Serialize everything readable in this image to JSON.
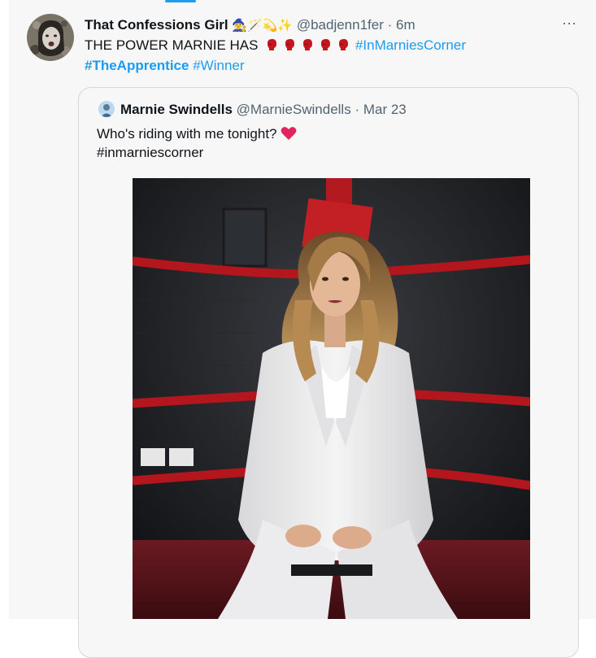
{
  "tweet": {
    "name": "That Confessions Girl",
    "name_emojis": "🧙‍♀️🪄💫✨",
    "handle": "@badjenn1fer",
    "separator": "·",
    "time": "6m",
    "more_label": "···",
    "line1_text": "THE POWER MARNIE HAS",
    "line1_hashtag": "#InMarniesCorner",
    "line2_hashtag1": "#TheApprentice",
    "line2_hashtag2": "#Winner"
  },
  "quote": {
    "name": "Marnie Swindells",
    "handle": "@MarnieSwindells",
    "separator": "·",
    "date": "Mar 23",
    "text": "Who's riding with me tonight?",
    "hashtag": "#inmarniescorner"
  },
  "colors": {
    "accent": "#1d9bf0",
    "heart": "#e0245e",
    "glove": "#c4161c"
  },
  "icons": {
    "more": "more-horizontal-icon",
    "glove": "boxing-glove-icon",
    "heart": "red-heart-icon"
  }
}
